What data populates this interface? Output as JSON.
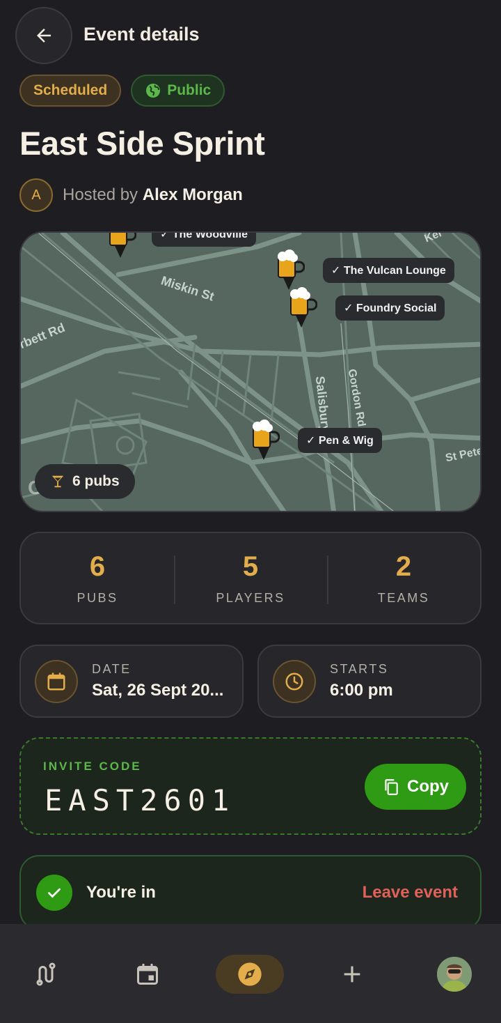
{
  "header": {
    "title": "Event details"
  },
  "badges": {
    "status": "Scheduled",
    "visibility": "Public"
  },
  "event": {
    "title": "East Side Sprint",
    "host_prefix": "Hosted by",
    "host_name": "Alex Morgan",
    "host_initial": "A"
  },
  "map": {
    "pub_chip": "6 pubs",
    "attribution": "Google",
    "labels": [
      "✓ The Woodville",
      "✓ The Vulcan Lounge",
      "✓ Foundry Social",
      "✓ Pen & Wig"
    ],
    "streets": [
      "Miskin St",
      "rbett Rd",
      "Salisbury Rd",
      "Gordon Rd",
      "St Pete",
      "Ker"
    ]
  },
  "stats": [
    {
      "value": "6",
      "label": "PUBS"
    },
    {
      "value": "5",
      "label": "PLAYERS"
    },
    {
      "value": "2",
      "label": "TEAMS"
    }
  ],
  "date": {
    "label": "DATE",
    "value": "Sat, 26 Sept 20..."
  },
  "starts": {
    "label": "STARTS",
    "value": "6:00 pm"
  },
  "invite": {
    "label": "INVITE CODE",
    "code": "EAST2601",
    "copy_label": "Copy"
  },
  "membership": {
    "status": "You're in",
    "leave_label": "Leave event"
  },
  "colors": {
    "accent": "#e2ad4a",
    "green": "#2f9a14",
    "danger": "#e0615a",
    "background": "#1d1d22"
  },
  "nav": {
    "items": [
      {
        "icon": "route-icon",
        "active": false
      },
      {
        "icon": "calendar-icon",
        "active": false
      },
      {
        "icon": "compass-icon",
        "active": true
      },
      {
        "icon": "plus-icon",
        "active": false
      },
      {
        "icon": "profile-avatar",
        "active": false
      }
    ]
  }
}
